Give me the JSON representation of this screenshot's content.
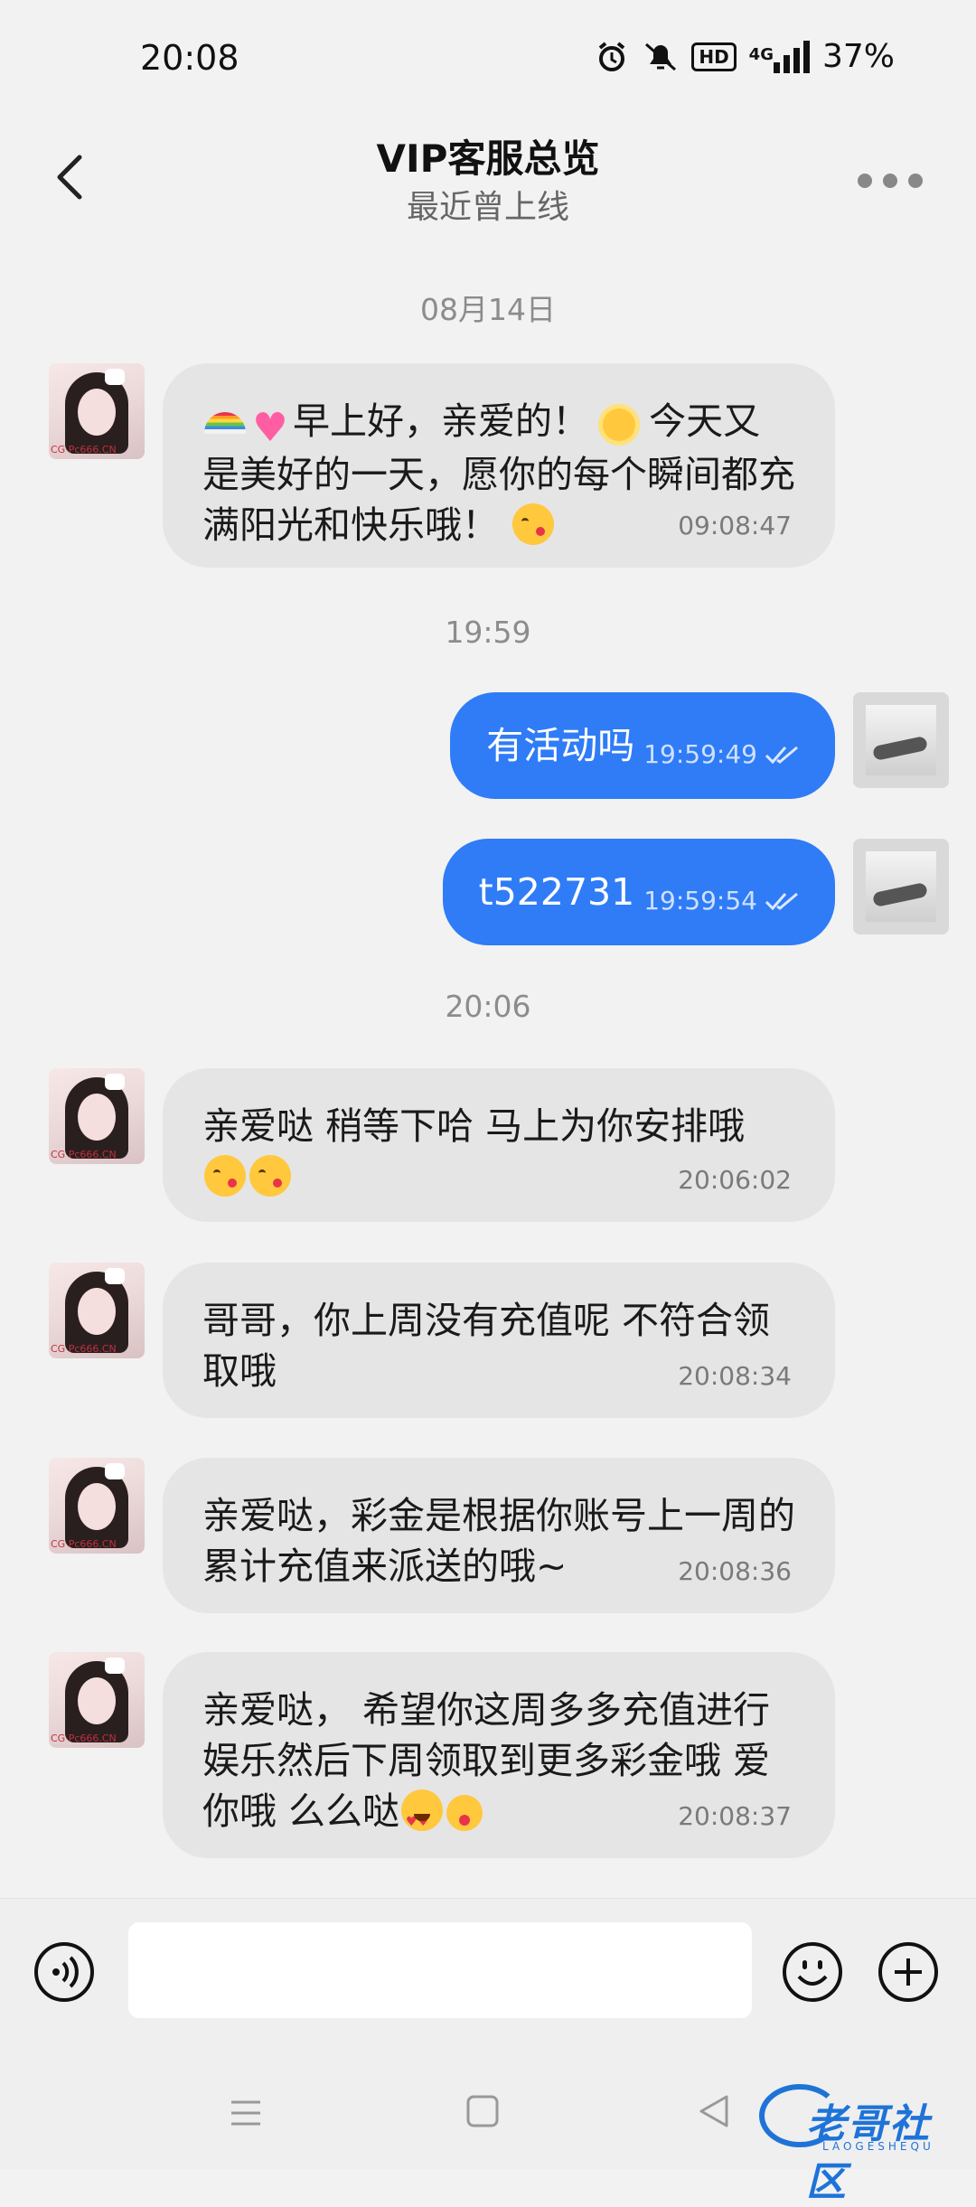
{
  "status_bar": {
    "time": "20:08",
    "network": "4G",
    "hd_label": "HD",
    "battery": "37%"
  },
  "header": {
    "title": "VIP客服总览",
    "subtitle": "最近曾上线"
  },
  "dividers": [
    "08月14日",
    "19:59",
    "20:06"
  ],
  "messages": [
    {
      "direction": "incoming",
      "text_a": "早上好，亲爱的！",
      "text_b": "今天又是美好的一天，愿你的每个瞬间都充满阳光和快乐哦！",
      "time": "09:08:47"
    },
    {
      "direction": "outgoing",
      "text": "有活动吗",
      "time": "19:59:49"
    },
    {
      "direction": "outgoing",
      "text": "t522731",
      "time": "19:59:54"
    },
    {
      "direction": "incoming",
      "text": "亲爱哒 稍等下哈 马上为你安排哦",
      "time": "20:06:02"
    },
    {
      "direction": "incoming",
      "text": "哥哥，你上周没有充值呢 不符合领取哦",
      "time": "20:08:34"
    },
    {
      "direction": "incoming",
      "text": "亲爱哒，彩金是根据你账号上一周的累计充值来派送的哦~",
      "time": "20:08:36"
    },
    {
      "direction": "incoming",
      "text": "亲爱哒， 希望你这周多多充值进行娱乐然后下周领取到更多彩金哦 爱你哦 么么哒",
      "time": "20:08:37"
    }
  ],
  "input": {
    "value": "",
    "placeholder": ""
  },
  "icons": {
    "back": "chevron-left-icon",
    "more": "more-dots-icon",
    "voice": "voice-icon",
    "emoji": "emoji-icon",
    "plus": "plus-icon",
    "read": "double-check-icon"
  },
  "colors": {
    "outgoing_bubble": "#2f7cf6",
    "incoming_bubble": "#e5e5e5",
    "background": "#f2f2f2"
  },
  "watermark": {
    "text": "老哥社区",
    "sub": "LAOGESHEQU"
  }
}
